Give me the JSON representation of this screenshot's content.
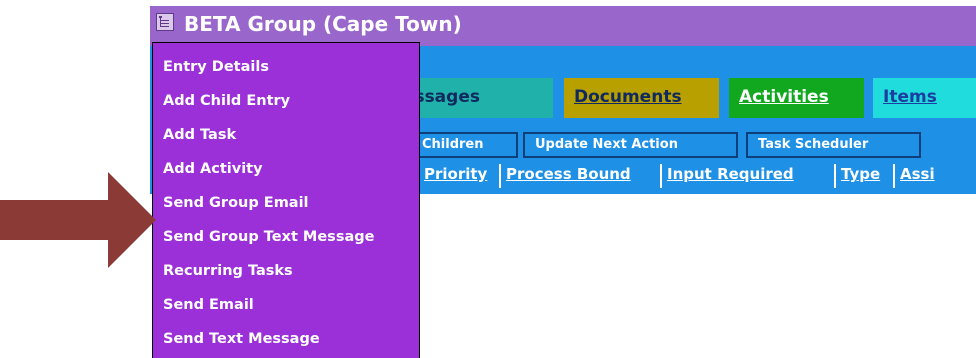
{
  "window": {
    "title": "BETA Group (Cape Town)",
    "icon": "tree-menu-icon"
  },
  "tabs": [
    {
      "label": "Messages",
      "color": "#20b2aa"
    },
    {
      "label": "Documents",
      "color": "#b8a000"
    },
    {
      "label": "Activities",
      "color": "#11a820"
    },
    {
      "label": "Items",
      "color": "#20dcdc"
    }
  ],
  "toolbar": {
    "children_label": "Children",
    "update_next_action_label": "Update Next Action",
    "task_scheduler_label": "Task Scheduler"
  },
  "columns": [
    "Priority",
    "Process Bound",
    "Input Required",
    "Type",
    "Assi"
  ],
  "context_menu": {
    "items": [
      "Entry Details",
      "Add Child Entry",
      "Add Task",
      "Add Activity",
      "Send Group Email",
      "Send Group Text Message",
      "Recurring Tasks",
      "Send Email",
      "Send Text Message"
    ],
    "background": "#9b30d8"
  },
  "annotation": {
    "icon": "pointer-arrow-icon",
    "color": "#8b3a36"
  },
  "colors": {
    "title_bar": "#9966cc",
    "tab_strip": "#1e90e6"
  }
}
